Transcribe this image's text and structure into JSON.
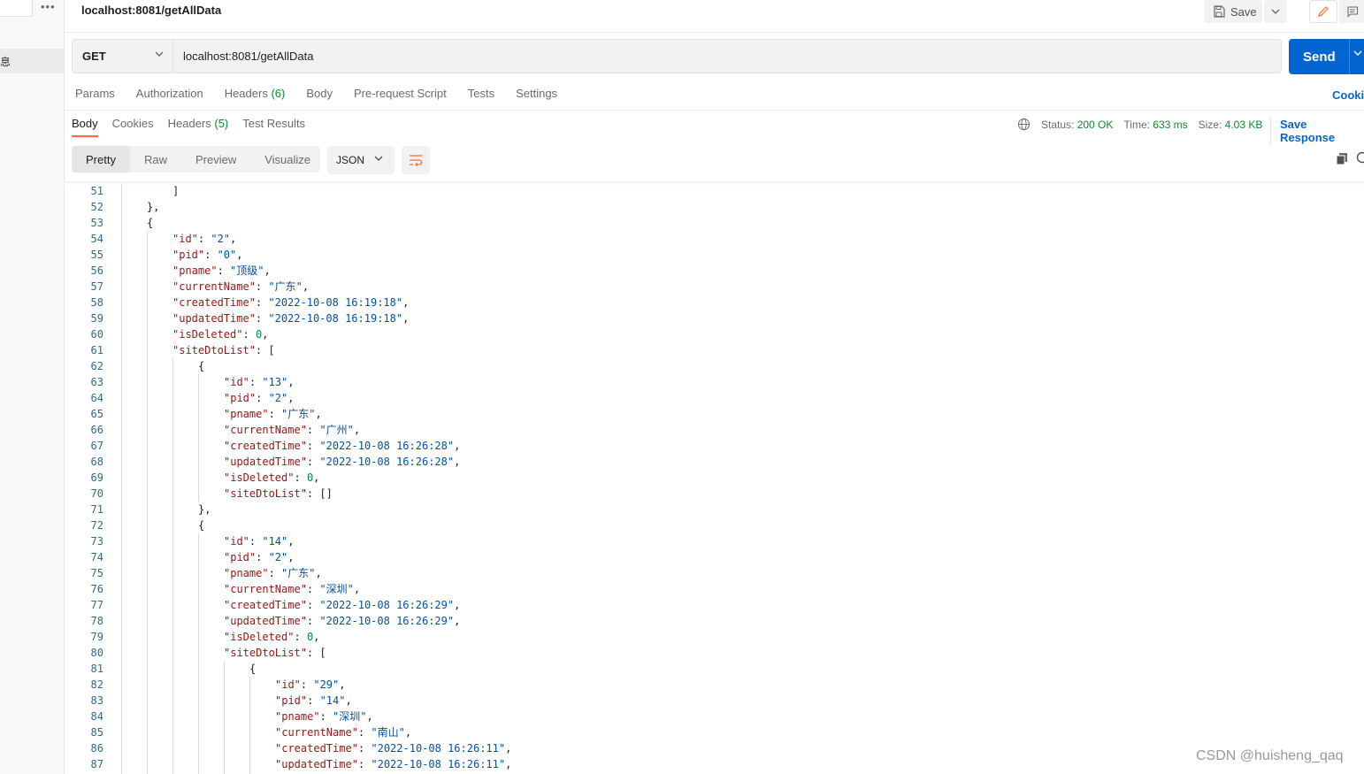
{
  "sidebar": {
    "more_label": "•••",
    "selected_label": "息"
  },
  "request": {
    "title": "localhost:8081/getAllData",
    "save_label": "Save",
    "method": "GET",
    "url": "localhost:8081/getAllData",
    "send_label": "Send",
    "cookies_label": "Cookie",
    "tabs": [
      {
        "label": "Params",
        "count": ""
      },
      {
        "label": "Authorization",
        "count": ""
      },
      {
        "label": "Headers ",
        "count": "(6)"
      },
      {
        "label": "Body",
        "count": ""
      },
      {
        "label": "Pre-request Script",
        "count": ""
      },
      {
        "label": "Tests",
        "count": ""
      },
      {
        "label": "Settings",
        "count": ""
      }
    ]
  },
  "response": {
    "tabs": [
      {
        "label": "Body",
        "count": ""
      },
      {
        "label": "Cookies",
        "count": ""
      },
      {
        "label": "Headers ",
        "count": "(5)"
      },
      {
        "label": "Test Results",
        "count": ""
      }
    ],
    "status_label": "Status: ",
    "status_value": "200 OK",
    "time_label": "Time: ",
    "time_value": "633 ms",
    "size_label": "Size: ",
    "size_value": "4.03 KB",
    "save_response_label": "Save Response",
    "view_tabs": [
      "Pretty",
      "Raw",
      "Preview",
      "Visualize"
    ],
    "format": "JSON"
  },
  "code_lines": [
    {
      "n": "51",
      "indent": 3,
      "t": "]"
    },
    {
      "n": "52",
      "indent": 2,
      "t": "},"
    },
    {
      "n": "53",
      "indent": 2,
      "t": "{"
    },
    {
      "n": "54",
      "indent": 3,
      "k": "\"id\"",
      "v": "\"2\"",
      "vt": "s",
      "c": ","
    },
    {
      "n": "55",
      "indent": 3,
      "k": "\"pid\"",
      "v": "\"0\"",
      "vt": "s",
      "c": ","
    },
    {
      "n": "56",
      "indent": 3,
      "k": "\"pname\"",
      "v": "\"顶级\"",
      "vt": "s",
      "c": ","
    },
    {
      "n": "57",
      "indent": 3,
      "k": "\"currentName\"",
      "v": "\"广东\"",
      "vt": "s",
      "c": ","
    },
    {
      "n": "58",
      "indent": 3,
      "k": "\"createdTime\"",
      "v": "\"2022-10-08 16:19:18\"",
      "vt": "s",
      "c": ","
    },
    {
      "n": "59",
      "indent": 3,
      "k": "\"updatedTime\"",
      "v": "\"2022-10-08 16:19:18\"",
      "vt": "s",
      "c": ","
    },
    {
      "n": "60",
      "indent": 3,
      "k": "\"isDeleted\"",
      "v": "0",
      "vt": "n",
      "c": ","
    },
    {
      "n": "61",
      "indent": 3,
      "k": "\"siteDtoList\"",
      "v": "[",
      "vt": "p",
      "c": ""
    },
    {
      "n": "62",
      "indent": 4,
      "t": "{"
    },
    {
      "n": "63",
      "indent": 5,
      "k": "\"id\"",
      "v": "\"13\"",
      "vt": "s",
      "c": ","
    },
    {
      "n": "64",
      "indent": 5,
      "k": "\"pid\"",
      "v": "\"2\"",
      "vt": "s",
      "c": ","
    },
    {
      "n": "65",
      "indent": 5,
      "k": "\"pname\"",
      "v": "\"广东\"",
      "vt": "s",
      "c": ","
    },
    {
      "n": "66",
      "indent": 5,
      "k": "\"currentName\"",
      "v": "\"广州\"",
      "vt": "s",
      "c": ","
    },
    {
      "n": "67",
      "indent": 5,
      "k": "\"createdTime\"",
      "v": "\"2022-10-08 16:26:28\"",
      "vt": "s",
      "c": ","
    },
    {
      "n": "68",
      "indent": 5,
      "k": "\"updatedTime\"",
      "v": "\"2022-10-08 16:26:28\"",
      "vt": "s",
      "c": ","
    },
    {
      "n": "69",
      "indent": 5,
      "k": "\"isDeleted\"",
      "v": "0",
      "vt": "n",
      "c": ","
    },
    {
      "n": "70",
      "indent": 5,
      "k": "\"siteDtoList\"",
      "v": "[]",
      "vt": "p",
      "c": ""
    },
    {
      "n": "71",
      "indent": 4,
      "t": "},"
    },
    {
      "n": "72",
      "indent": 4,
      "t": "{"
    },
    {
      "n": "73",
      "indent": 5,
      "k": "\"id\"",
      "v": "\"14\"",
      "vt": "s",
      "c": ","
    },
    {
      "n": "74",
      "indent": 5,
      "k": "\"pid\"",
      "v": "\"2\"",
      "vt": "s",
      "c": ","
    },
    {
      "n": "75",
      "indent": 5,
      "k": "\"pname\"",
      "v": "\"广东\"",
      "vt": "s",
      "c": ","
    },
    {
      "n": "76",
      "indent": 5,
      "k": "\"currentName\"",
      "v": "\"深圳\"",
      "vt": "s",
      "c": ","
    },
    {
      "n": "77",
      "indent": 5,
      "k": "\"createdTime\"",
      "v": "\"2022-10-08 16:26:29\"",
      "vt": "s",
      "c": ","
    },
    {
      "n": "78",
      "indent": 5,
      "k": "\"updatedTime\"",
      "v": "\"2022-10-08 16:26:29\"",
      "vt": "s",
      "c": ","
    },
    {
      "n": "79",
      "indent": 5,
      "k": "\"isDeleted\"",
      "v": "0",
      "vt": "n",
      "c": ","
    },
    {
      "n": "80",
      "indent": 5,
      "k": "\"siteDtoList\"",
      "v": "[",
      "vt": "p",
      "c": ""
    },
    {
      "n": "81",
      "indent": 6,
      "t": "{"
    },
    {
      "n": "82",
      "indent": 7,
      "k": "\"id\"",
      "v": "\"29\"",
      "vt": "s",
      "c": ","
    },
    {
      "n": "83",
      "indent": 7,
      "k": "\"pid\"",
      "v": "\"14\"",
      "vt": "s",
      "c": ","
    },
    {
      "n": "84",
      "indent": 7,
      "k": "\"pname\"",
      "v": "\"深圳\"",
      "vt": "s",
      "c": ","
    },
    {
      "n": "85",
      "indent": 7,
      "k": "\"currentName\"",
      "v": "\"南山\"",
      "vt": "s",
      "c": ","
    },
    {
      "n": "86",
      "indent": 7,
      "k": "\"createdTime\"",
      "v": "\"2022-10-08 16:26:11\"",
      "vt": "s",
      "c": ","
    },
    {
      "n": "87",
      "indent": 7,
      "k": "\"updatedTime\"",
      "v": "\"2022-10-08 16:26:11\"",
      "vt": "s",
      "c": ","
    }
  ],
  "watermark": "CSDN @huisheng_qaq",
  "colors": {
    "accent": "#0265d2",
    "tab_underline": "#ff6c37",
    "ok": "#0b8a2e",
    "json_key": "#a31515",
    "json_string": "#0451a5",
    "json_number": "#098658"
  }
}
